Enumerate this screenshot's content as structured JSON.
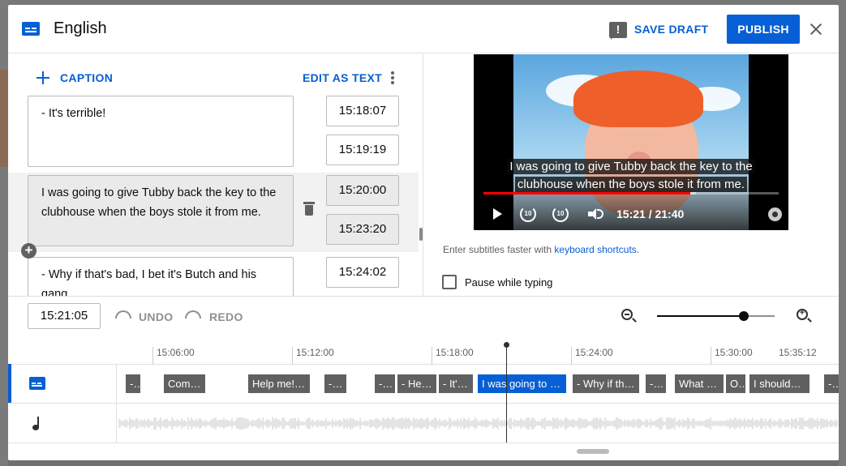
{
  "header": {
    "title": "English",
    "save_draft": "SAVE DRAFT",
    "publish": "PUBLISH"
  },
  "editor": {
    "add_caption": "CAPTION",
    "edit_as_text": "EDIT AS TEXT",
    "captions": [
      {
        "text": "- It's terrible!",
        "start": "15:18:07",
        "end": "15:19:19"
      },
      {
        "text": "I was going to give Tubby back the key to the clubhouse when the boys stole it from me.",
        "start": "15:20:00",
        "end": "15:23:20"
      },
      {
        "text": "- Why if that's bad, I bet it's Butch and his gang.",
        "start": "15:24:02",
        "end": ""
      }
    ]
  },
  "player": {
    "subtitle_line1": "I was going to give Tubby back the key to the",
    "subtitle_line2": "clubhouse when the boys stole it from me.",
    "time": "15:21 / 21:40",
    "progress": 0.7,
    "buffered": 0.72,
    "replay_label": "10",
    "forward_label": "10"
  },
  "hint": {
    "prefix": "Enter subtitles faster with ",
    "link": "keyboard shortcuts",
    "suffix": "."
  },
  "pause_while_typing": "Pause while typing",
  "toolbar": {
    "current_time": "15:21:05",
    "undo": "UNDO",
    "redo": "REDO",
    "zoom_level": 0.74
  },
  "timeline": {
    "ticks": [
      "15:06:00",
      "15:12:00",
      "15:18:00",
      "15:24:00",
      "15:30:00",
      "15:35:12"
    ],
    "clips": [
      {
        "label": "-…",
        "active": false
      },
      {
        "label": "Com…",
        "active": false
      },
      {
        "label": "Help me! …",
        "active": false
      },
      {
        "label": "- …",
        "active": false
      },
      {
        "label": "- …",
        "active": false
      },
      {
        "label": "- He'…",
        "active": false
      },
      {
        "label": "- It's…",
        "active": false
      },
      {
        "label": "I was going to …",
        "active": true
      },
      {
        "label": "- Why if th…",
        "active": false
      },
      {
        "label": "-…",
        "active": false
      },
      {
        "label": "What a…",
        "active": false
      },
      {
        "label": "O…",
        "active": false
      },
      {
        "label": "I shouldn'…",
        "active": false
      },
      {
        "label": "- I",
        "active": false
      }
    ]
  }
}
